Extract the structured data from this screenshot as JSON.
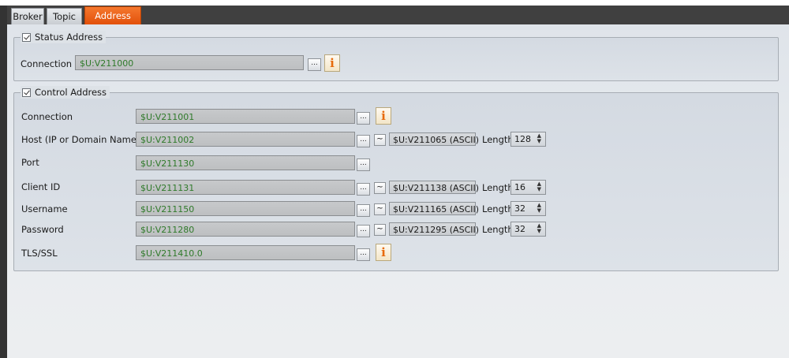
{
  "tabs": [
    "Broker",
    "Topic",
    "Address"
  ],
  "active_tab": "Address",
  "status_group": {
    "legend": "Status Address",
    "checked": true,
    "connection_label": "Connection",
    "connection_value": "$U:V211000"
  },
  "control_group": {
    "legend": "Control Address",
    "checked": true,
    "rows": [
      {
        "label": "Connection",
        "value": "$U:V211001"
      },
      {
        "label": "Host (IP or Domain Name)",
        "value": "$U:V211002",
        "ascii": "$U:V211065 (ASCII)",
        "length_label": "Length",
        "length": "128"
      },
      {
        "label": "Port",
        "value": "$U:V211130"
      },
      {
        "label": "Client ID",
        "value": "$U:V211131",
        "ascii": "$U:V211138 (ASCII)",
        "length_label": "Length",
        "length": "16"
      },
      {
        "label": "Username",
        "value": "$U:V211150",
        "ascii": "$U:V211165 (ASCII)",
        "length_label": "Length",
        "length": "32"
      },
      {
        "label": "Password",
        "value": "$U:V211280",
        "ascii": "$U:V211295 (ASCII)",
        "length_label": "Length",
        "length": "32"
      },
      {
        "label": "TLS/SSL",
        "value": "$U:V211410.0"
      }
    ]
  },
  "browse_button_label": "...",
  "tilde_label": "~",
  "info_glyph": "i",
  "spinner_arrows": "▲▼",
  "icons": {
    "info": "info-icon",
    "checkbox": "checkbox-checked"
  },
  "colors": {
    "active_tab": "#f05a14",
    "address_text": "#2f7a2a",
    "info_icon": "#e76a0c"
  }
}
